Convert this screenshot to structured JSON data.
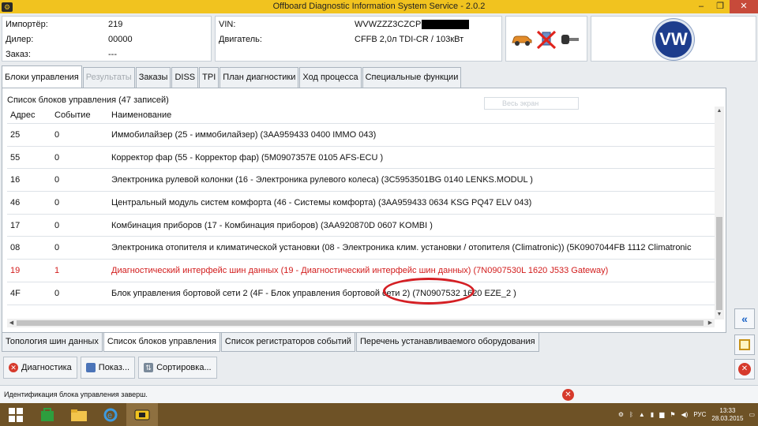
{
  "window": {
    "title": "Offboard Diagnostic Information System Service - 2.0.2",
    "minimize": "–",
    "restore": "❐",
    "close": "✕"
  },
  "header": {
    "importer_label": "Импортёр:",
    "importer_value": "219",
    "dealer_label": "Дилер:",
    "dealer_value": "00000",
    "order_label": "Заказ:",
    "order_value": "---",
    "vin_label": "VIN:",
    "vin_value": "WVWZZZ3CZCP",
    "engine_label": "Двигатель:",
    "engine_value": "CFFB 2,0л TDI-CR / 103кВт",
    "logo_text": "VW"
  },
  "tabs": [
    {
      "label": "Блоки управления",
      "state": "active"
    },
    {
      "label": "Результаты",
      "state": "disabled"
    },
    {
      "label": "Заказы",
      "state": "normal"
    },
    {
      "label": "DISS",
      "state": "normal"
    },
    {
      "label": "TPI",
      "state": "normal"
    },
    {
      "label": "План диагностики",
      "state": "normal"
    },
    {
      "label": "Ход процесса",
      "state": "normal"
    },
    {
      "label": "Специальные функции",
      "state": "normal"
    }
  ],
  "list": {
    "title": "Список блоков управления (47 записей)",
    "filter_placeholder": "Весь экран",
    "columns": [
      "Адрес",
      "Событие",
      "Наименование"
    ],
    "rows": [
      {
        "address": "25",
        "event": "0",
        "name": "Иммобилайзер (25 - иммобилайзер) (3AA959433      0400      IMMO        043)"
      },
      {
        "address": "55",
        "event": "0",
        "name": "Корректор фар (55 - Корректор фар) (5M0907357E    0105    AFS-ECU      )"
      },
      {
        "address": "16",
        "event": "0",
        "name": "Электроника рулевой колонки (16 - Электроника рулевого колеса) (3C5953501BG   0140   LENKS.MODUL  )"
      },
      {
        "address": "46",
        "event": "0",
        "name": "Центральный модуль систем комфорта (46 - Системы комфорта) (3AA959433      0634      KSG PQ47 ELV 043)"
      },
      {
        "address": "17",
        "event": "0",
        "name": "Комбинация приборов (17 - Комбинация приборов) (3AA920870D     0607   KOMBI       )"
      },
      {
        "address": "08",
        "event": "0",
        "name": "Электроника отопителя и климатической установки (08 - Электроника клим. установки / отопителя  (Climatronic)) (5K0907044FB    1112    Climatronic"
      },
      {
        "address": "19",
        "event": "1",
        "name": "Диагностический интерфейс шин данных (19 - Диагностический интерфейс шин данных) (7N0907530L     1620   J533  Gateway)",
        "error": true
      },
      {
        "address": "4F",
        "event": "0",
        "name": "Блок управления бортовой сети 2 (4F - Блок управления бортовой сети 2) (7N0907532      1620    EZE_2        )"
      }
    ]
  },
  "bottom_tabs": [
    {
      "label": "Топология шин данных",
      "state": "normal"
    },
    {
      "label": "Список блоков управления",
      "state": "active"
    },
    {
      "label": "Список регистраторов событий",
      "state": "normal"
    },
    {
      "label": "Перечень устанавливаемого оборудования",
      "state": "normal"
    }
  ],
  "buttons": {
    "diagnostics": "Диагностика",
    "show": "Показ...",
    "sort": "Сортировка..."
  },
  "right_buttons": {
    "back": "«",
    "close": "✕"
  },
  "status": {
    "text": "Идентификация блока управления заверш.",
    "error": "✕"
  },
  "taskbar": {
    "language": "РУС",
    "time": "13:33",
    "date": "28.03.2015"
  }
}
